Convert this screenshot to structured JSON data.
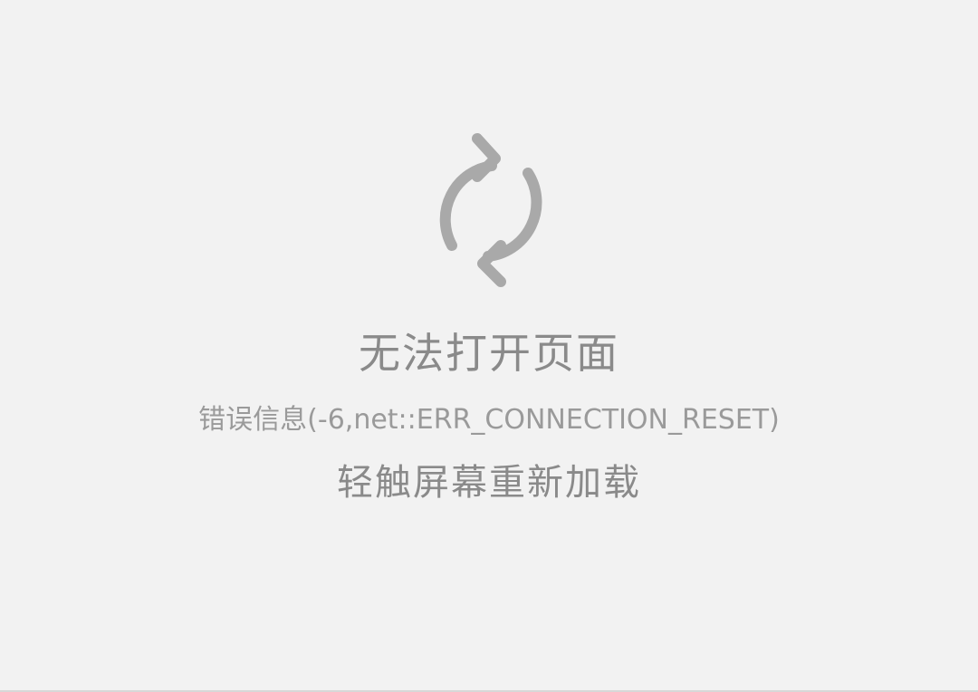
{
  "error_page": {
    "icon": "reload-icon",
    "title": "无法打开页面",
    "error_info": "错误信息(-6,net::ERR_CONNECTION_RESET)",
    "reload_hint": "轻触屏幕重新加载"
  },
  "colors": {
    "background": "#f2f2f2",
    "icon": "#a9a9a9",
    "text": "#8a8a8a"
  }
}
